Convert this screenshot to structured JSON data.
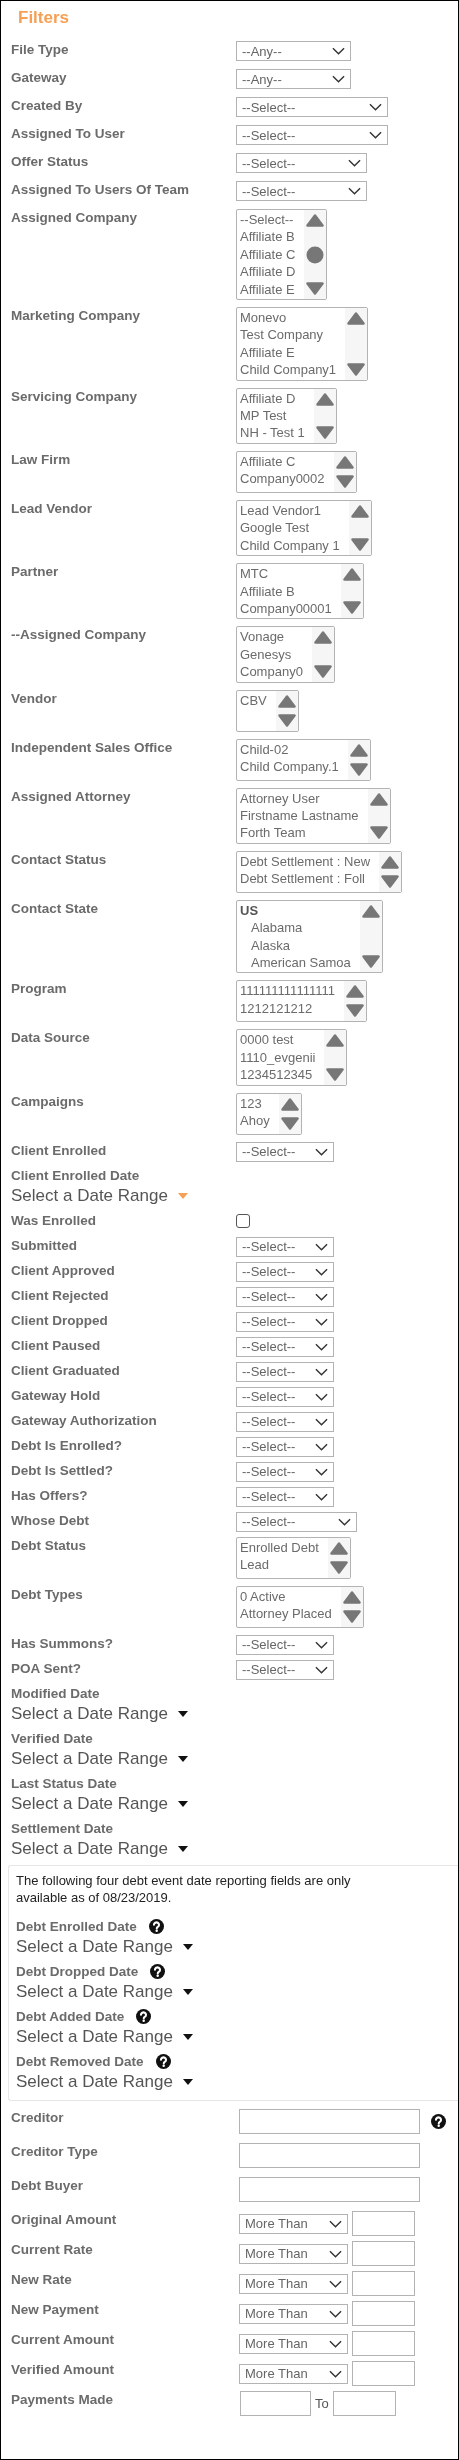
{
  "title": "Filters",
  "fields": [
    {
      "kind": "select",
      "label": "File Type",
      "value": "--Any--"
    },
    {
      "kind": "select",
      "label": "Gateway",
      "value": "--Any--"
    },
    {
      "kind": "select",
      "label": "Created By",
      "value": "--Select--"
    },
    {
      "kind": "select",
      "label": "Assigned To User",
      "value": "--Select--"
    },
    {
      "kind": "select",
      "label": "Offer Status",
      "value": "--Select--"
    },
    {
      "kind": "select",
      "label": "Assigned To Users Of Team",
      "value": "--Select--"
    },
    {
      "kind": "listbox",
      "label": "Assigned Company",
      "options": [
        "--Select--",
        "Affiliate B",
        "Affiliate C",
        "Affiliate D",
        "Affiliate E"
      ]
    },
    {
      "kind": "listbox",
      "label": "Marketing Company",
      "options": [
        "Monevo",
        "Test Company",
        "Affiliate E",
        "Child Company1"
      ]
    },
    {
      "kind": "listbox",
      "label": "Servicing Company",
      "options": [
        "Affiliate D",
        "MP Test",
        "NH - Test 1"
      ]
    },
    {
      "kind": "listbox",
      "label": "Law Firm",
      "options": [
        "Affiliate C",
        "Company0002"
      ]
    },
    {
      "kind": "listbox",
      "label": "Lead Vendor",
      "options": [
        "Lead Vendor1",
        "Google Test",
        "Child Company 1"
      ]
    },
    {
      "kind": "listbox",
      "label": "Partner",
      "options": [
        "MTC",
        "Affiliate B",
        "Company00001"
      ]
    },
    {
      "kind": "listbox",
      "label": "--Assigned Company",
      "options": [
        "Vonage",
        "Genesys",
        "Company0"
      ]
    },
    {
      "kind": "listbox",
      "label": "Vendor",
      "options": [
        "CBV"
      ]
    },
    {
      "kind": "listbox",
      "label": "Independent Sales Office",
      "options": [
        "Child-02",
        "Child Company.1"
      ]
    },
    {
      "kind": "listbox",
      "label": "Assigned Attorney",
      "options": [
        "Attorney User",
        "Firstname Lastname",
        "Forth Team"
      ]
    },
    {
      "kind": "listbox",
      "label": "Contact Status",
      "options": [
        "Debt Settlement : New",
        "Debt Settlement : Foll"
      ]
    },
    {
      "kind": "listbox",
      "label": "Contact State",
      "groups": [
        {
          "label": "US",
          "children": [
            "Alabama",
            "Alaska",
            "American Samoa"
          ]
        }
      ]
    },
    {
      "kind": "listbox",
      "label": "Program",
      "options": [
        "111111111111111",
        "1212121212"
      ]
    },
    {
      "kind": "listbox",
      "label": "Data Source",
      "options": [
        "0000 test",
        "1110_evgenii",
        "1234512345"
      ]
    },
    {
      "kind": "listbox",
      "label": "Campaigns",
      "options": [
        "123",
        "Ahoy"
      ]
    },
    {
      "kind": "select",
      "label": "Client Enrolled",
      "value": "--Select--"
    },
    {
      "kind": "daterange",
      "label": "Client Enrolled Date",
      "value": "Select a Date Range",
      "highlighted": true
    },
    {
      "kind": "checkbox",
      "label": "Was Enrolled",
      "checked": false
    },
    {
      "kind": "select",
      "label": "Submitted",
      "value": "--Select--"
    },
    {
      "kind": "select",
      "label": "Client Approved",
      "value": "--Select--"
    },
    {
      "kind": "select",
      "label": "Client Rejected",
      "value": "--Select--"
    },
    {
      "kind": "select",
      "label": "Client Dropped",
      "value": "--Select--"
    },
    {
      "kind": "select",
      "label": "Client Paused",
      "value": "--Select--"
    },
    {
      "kind": "select",
      "label": "Client Graduated",
      "value": "--Select--"
    },
    {
      "kind": "select",
      "label": "Gateway Hold",
      "value": "--Select--"
    },
    {
      "kind": "select",
      "label": "Gateway Authorization",
      "value": "--Select--"
    },
    {
      "kind": "select",
      "label": "Debt Is Enrolled?",
      "value": "--Select--"
    },
    {
      "kind": "select",
      "label": "Debt Is Settled?",
      "value": "--Select--"
    },
    {
      "kind": "select",
      "label": "Has Offers?",
      "value": "--Select--"
    },
    {
      "kind": "select",
      "label": "Whose Debt",
      "value": "--Select--"
    },
    {
      "kind": "listbox",
      "label": "Debt Status",
      "options": [
        "Enrolled Debt",
        "Lead"
      ]
    },
    {
      "kind": "listbox",
      "label": "Debt Types",
      "options": [
        "0 Active",
        "Attorney Placed"
      ]
    },
    {
      "kind": "select",
      "label": "Has Summons?",
      "value": "--Select--"
    },
    {
      "kind": "select",
      "label": "POA Sent?",
      "value": "--Select--"
    },
    {
      "kind": "daterange",
      "label": "Modified Date",
      "value": "Select a Date Range",
      "highlighted": false
    },
    {
      "kind": "daterange",
      "label": "Verified Date",
      "value": "Select a Date Range",
      "highlighted": false
    },
    {
      "kind": "daterange",
      "label": "Last Status Date",
      "value": "Select a Date Range",
      "highlighted": false
    },
    {
      "kind": "daterange",
      "label": "Settlement Date",
      "value": "Select a Date Range",
      "highlighted": false
    },
    {
      "kind": "note",
      "text": "The following four debt event date reporting fields are only available as of 08/23/2019.",
      "fields": [
        {
          "kind": "daterange",
          "label": "Debt Enrolled Date",
          "value": "Select a Date Range",
          "highlighted": false,
          "help": true
        },
        {
          "kind": "daterange",
          "label": "Debt Dropped Date",
          "value": "Select a Date Range",
          "highlighted": false,
          "help": true
        },
        {
          "kind": "daterange",
          "label": "Debt Added Date",
          "value": "Select a Date Range",
          "highlighted": false,
          "help": true
        },
        {
          "kind": "daterange",
          "label": "Debt Removed Date",
          "value": "Select a Date Range",
          "highlighted": false,
          "help": true
        }
      ]
    },
    {
      "kind": "text",
      "label": "Creditor",
      "help": true
    },
    {
      "kind": "text",
      "label": "Creditor Type",
      "help": false
    },
    {
      "kind": "text",
      "label": "Debt Buyer",
      "help": false
    },
    {
      "kind": "amount",
      "label": "Original Amount",
      "operator": "More Than"
    },
    {
      "kind": "amount",
      "label": "Current Rate",
      "operator": "More Than"
    },
    {
      "kind": "amount",
      "label": "New Rate",
      "operator": "More Than"
    },
    {
      "kind": "amount",
      "label": "New Payment",
      "operator": "More Than"
    },
    {
      "kind": "amount",
      "label": "Current Amount",
      "operator": "More Than"
    },
    {
      "kind": "amount",
      "label": "Verified Amount",
      "operator": "More Than"
    },
    {
      "kind": "range",
      "label": "Payments Made",
      "separator": "To"
    }
  ]
}
